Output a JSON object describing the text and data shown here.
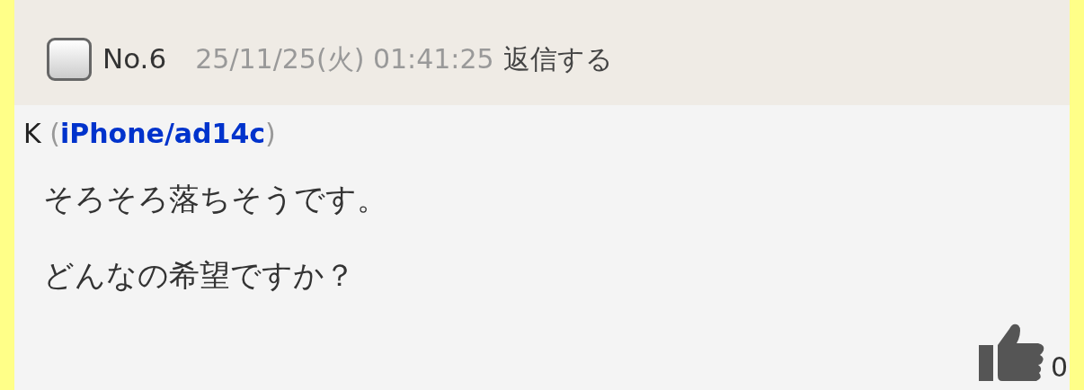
{
  "post": {
    "checked": false,
    "number": "No.6",
    "date": "25/11/25(火) 01:41:25",
    "reply_link": "返信する",
    "author": "K",
    "id_open": "(",
    "id": "iPhone/ad14c",
    "id_close": ")",
    "lines": [
      "そろそろ落ちそうです。",
      "どんなの希望ですか？"
    ],
    "likes": "0"
  }
}
